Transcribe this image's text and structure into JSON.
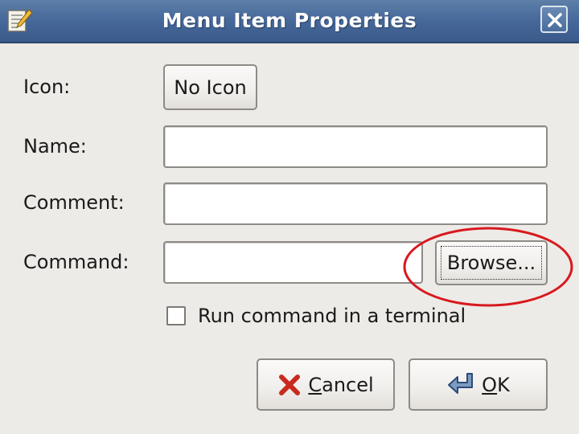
{
  "window": {
    "title": "Menu Item Properties",
    "icon": "edit-document-icon",
    "close_icon": "close-icon"
  },
  "form": {
    "icon_label": "Icon:",
    "icon_button": "No Icon",
    "name_label": "Name:",
    "name_value": "",
    "comment_label": "Comment:",
    "comment_value": "",
    "command_label": "Command:",
    "command_value": "",
    "browse_button": "Browse...",
    "terminal_checkbox_label": "Run command in a terminal",
    "terminal_checked": false
  },
  "actions": {
    "cancel_first": "C",
    "cancel_rest": "ancel",
    "cancel_icon": "red-x-icon",
    "ok_first": "O",
    "ok_rest": "K",
    "ok_icon": "enter-arrow-icon"
  },
  "annotation": {
    "shape": "ellipse",
    "color": "#d8191f",
    "target": "browse-button"
  }
}
